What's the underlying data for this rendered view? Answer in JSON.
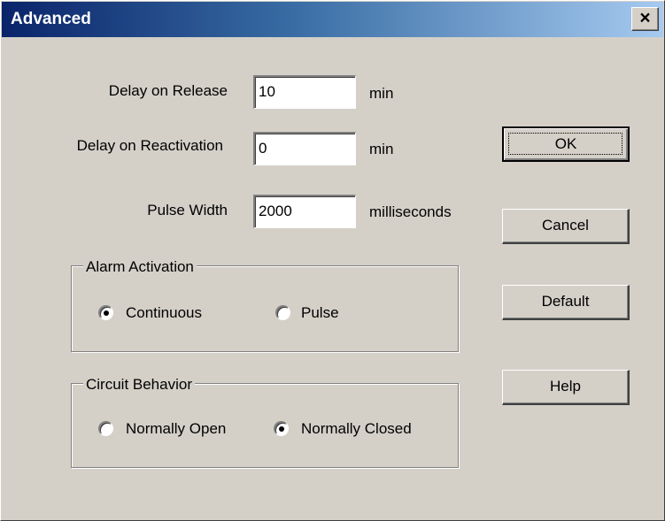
{
  "window": {
    "title": "Advanced",
    "close_glyph": "×"
  },
  "fields": [
    {
      "label": "Delay on Release",
      "value": "10",
      "unit": "min"
    },
    {
      "label": "Delay on Reactivation",
      "value": "0",
      "unit": "min"
    },
    {
      "label": "Pulse Width",
      "value": "2000",
      "unit": "milliseconds"
    }
  ],
  "alarm_activation": {
    "title": "Alarm Activation",
    "options": [
      {
        "label": "Continuous",
        "selected": true
      },
      {
        "label": "Pulse",
        "selected": false
      }
    ]
  },
  "circuit_behavior": {
    "title": "Circuit Behavior",
    "options": [
      {
        "label": "Normally Open",
        "selected": false
      },
      {
        "label": "Normally Closed",
        "selected": true
      }
    ]
  },
  "buttons": {
    "ok": "OK",
    "cancel": "Cancel",
    "default": "Default",
    "help": "Help"
  }
}
